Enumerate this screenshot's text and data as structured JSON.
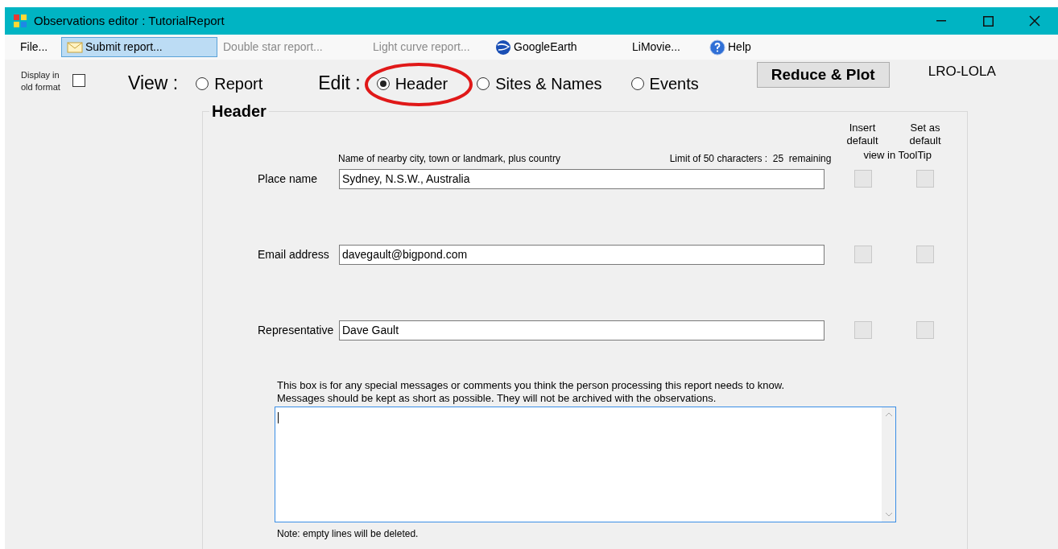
{
  "window": {
    "title": "Observations editor : TutorialReport"
  },
  "menu": [
    {
      "label": "File...",
      "kind": "plain",
      "selected": false,
      "disabled": false
    },
    {
      "label": "Submit report...",
      "kind": "mail",
      "selected": true,
      "disabled": false
    },
    {
      "label": "Double star report...",
      "kind": "plain",
      "selected": false,
      "disabled": true
    },
    {
      "label": "Light curve report...",
      "kind": "plain",
      "selected": false,
      "disabled": true
    },
    {
      "label": "GoogleEarth",
      "kind": "globe",
      "selected": false,
      "disabled": false
    },
    {
      "label": "LiMovie...",
      "kind": "plain",
      "selected": false,
      "disabled": false
    },
    {
      "label": "Help",
      "kind": "help",
      "selected": false,
      "disabled": false
    }
  ],
  "old_format": {
    "label": "Display in old format",
    "checked": false
  },
  "view": {
    "label": "View :",
    "options": [
      {
        "label": "Report",
        "selected": false
      }
    ]
  },
  "edit": {
    "label": "Edit :",
    "options": [
      {
        "label": "Header",
        "selected": true
      },
      {
        "label": "Sites & Names",
        "selected": false
      },
      {
        "label": "Events",
        "selected": false
      }
    ]
  },
  "reduce_button": "Reduce & Plot",
  "mission": "LRO-LOLA",
  "header": {
    "title": "Header",
    "insert_default_label": "Insert default",
    "set_default_label": "Set as default",
    "tooltip_label": "view in ToolTip",
    "hint": "Name of nearby city, town or landmark, plus country",
    "limit_text": "Limit of 50 characters :  25  remaining",
    "fields": [
      {
        "label": "Place name",
        "value": "Sydney, N.S.W., Australia",
        "insert_default": false,
        "set_default": false
      },
      {
        "label": "Email address",
        "value": "davegault@bigpond.com",
        "insert_default": false,
        "set_default": false
      },
      {
        "label": "Representative",
        "value": "Dave Gault",
        "insert_default": false,
        "set_default": false
      }
    ],
    "message_intro": "This box is for any special messages or comments you think the person processing this report needs to know.",
    "message_intro_2": "Messages should be kept as short as possible. They will not be archived with the observations.",
    "note": "Note:  empty lines will be deleted."
  }
}
